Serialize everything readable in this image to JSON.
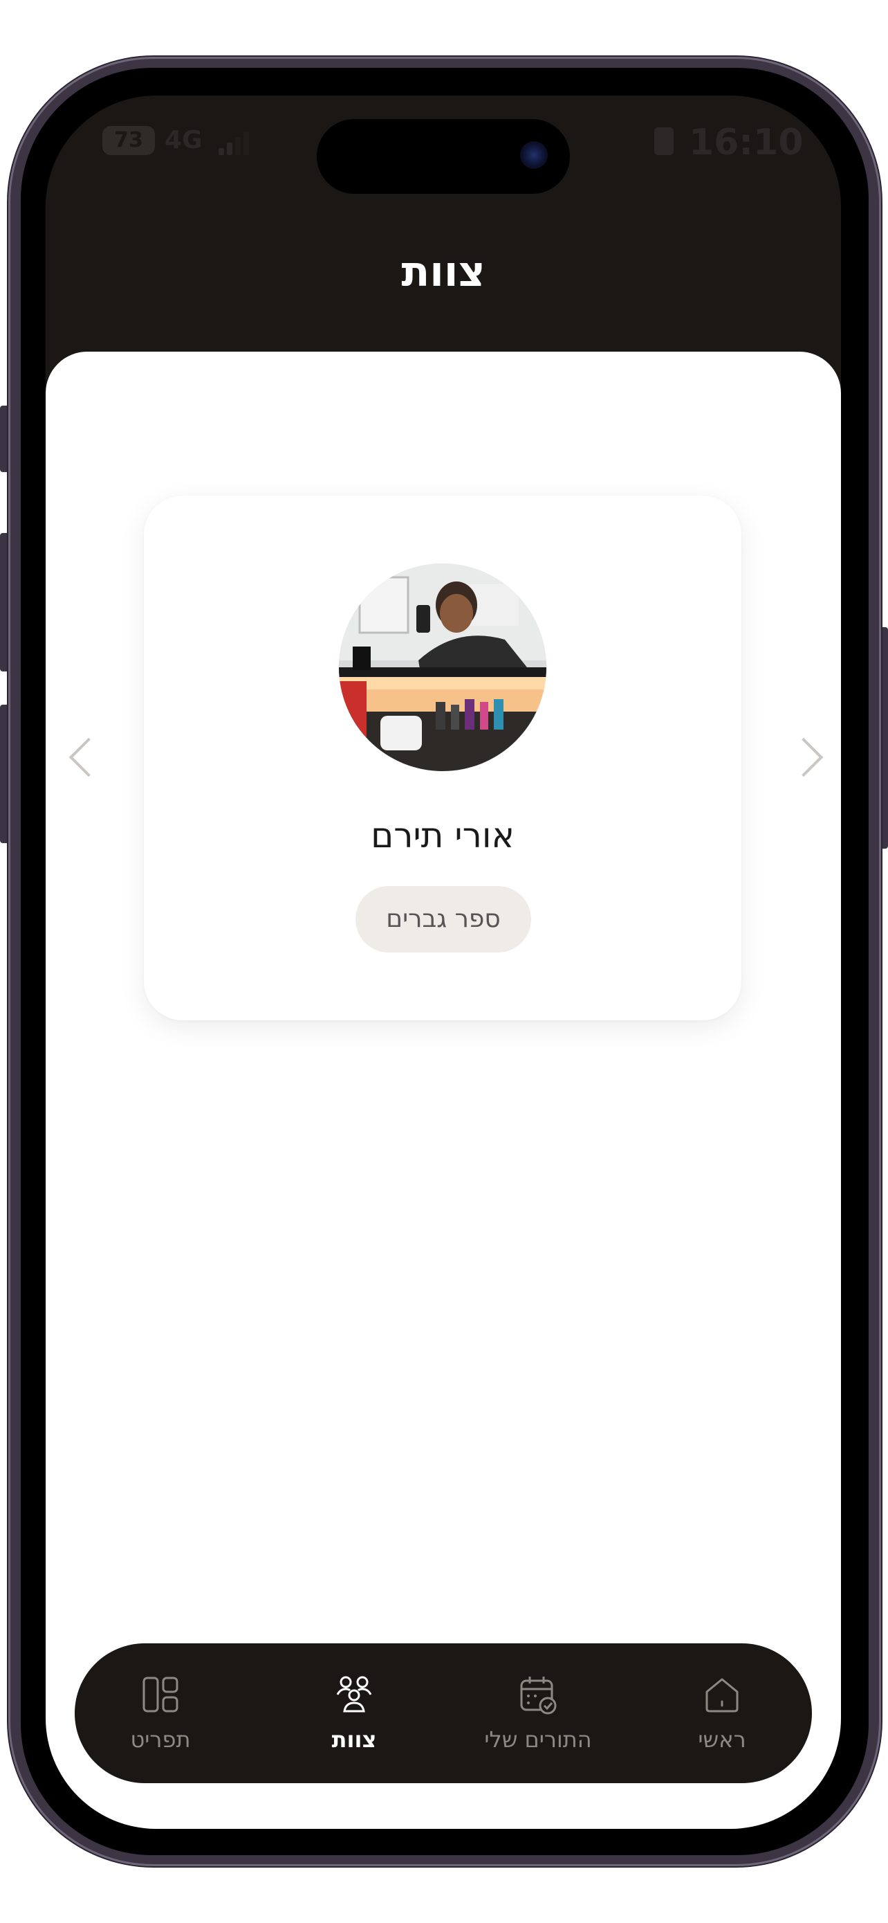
{
  "status_bar": {
    "battery": "73",
    "network": "4G",
    "time": "16:10"
  },
  "header": {
    "title": "צוות"
  },
  "team_card": {
    "name": "אורי תירם",
    "role": "ספר גברים"
  },
  "bottom_nav": {
    "items": [
      {
        "label": "תפריט",
        "icon": "menu-grid-icon",
        "active": false
      },
      {
        "label": "צוות",
        "icon": "team-icon",
        "active": true
      },
      {
        "label": "התורים שלי",
        "icon": "calendar-check-icon",
        "active": false
      },
      {
        "label": "ראשי",
        "icon": "home-icon",
        "active": false
      }
    ]
  },
  "colors": {
    "header_bg": "#1b1715",
    "nav_bg": "#1b1715",
    "chip_bg": "#efece8",
    "active_nav": "#ffffff",
    "inactive_nav": "#8e8883"
  }
}
